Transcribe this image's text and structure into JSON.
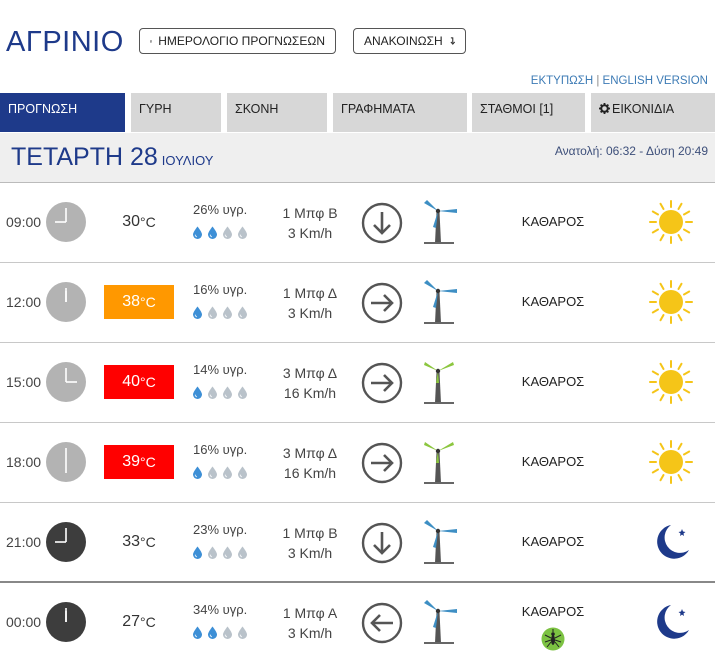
{
  "header": {
    "city": "ΑΓΡΙΝΙΟ",
    "calendar_button": "ΗΜΕΡΟΛΟΓΙΟ ΠΡΟΓΝΩΣΕΩΝ",
    "calendar_icon": "calendar-icon",
    "announcement_button": "ΑΝΑΚΟΙΝΩΣΗ",
    "announcement_icon": "arrow-down-icon"
  },
  "links": {
    "print": "ΕΚΤΥΠΩΣΗ",
    "separator": "|",
    "english": "ENGLISH VERSION"
  },
  "tabs": [
    {
      "label": "ΠΡΟΓΝΩΣΗ",
      "active": true
    },
    {
      "label": "ΓΥΡΗ"
    },
    {
      "label": "ΣΚΟΝΗ"
    },
    {
      "label": "ΓΡΑΦΗΜΑΤΑ"
    },
    {
      "label": "ΣΤΑΘΜΟΙ [1]"
    },
    {
      "label": "ΕΙΚΟΝΙΔΙΑ",
      "icon": "gear-icon"
    }
  ],
  "day": {
    "name": "ΤΕΤΑΡΤΗ 28",
    "month": "ΙΟΥΛΙΟΥ",
    "sun": "Ανατολή: 06:32  - Δύση 20:49"
  },
  "colors": {
    "brand": "#1e3a8a",
    "hot": "#ff9800",
    "very_hot": "#ff0000",
    "drop_filled": "#3d8fd6",
    "drop_empty": "#b9c2ca",
    "sun": "#f5c518",
    "moon": "#1e3a8a"
  },
  "units": {
    "temp": "°C"
  },
  "forecast": [
    {
      "time": "09:00",
      "temp": "30",
      "temp_level": "normal",
      "humidity": "26% υγρ.",
      "drops_filled": 2,
      "wind_bft": "1 Μπφ Β",
      "wind_kmh": "3 Km/h",
      "wind_dir": "arrow-down-icon",
      "turbine": "wind-turbine-icon",
      "condition": "ΚΑΘΑΡΟΣ",
      "weather_icon": "sun-icon",
      "dark_clock": false
    },
    {
      "time": "12:00",
      "temp": "38",
      "temp_level": "hot",
      "humidity": "16% υγρ.",
      "drops_filled": 1,
      "wind_bft": "1 Μπφ Δ",
      "wind_kmh": "3 Km/h",
      "wind_dir": "arrow-right-icon",
      "turbine": "wind-turbine-icon",
      "condition": "ΚΑΘΑΡΟΣ",
      "weather_icon": "sun-icon",
      "dark_clock": false
    },
    {
      "time": "15:00",
      "temp": "40",
      "temp_level": "very-hot",
      "humidity": "14% υγρ.",
      "drops_filled": 1,
      "wind_bft": "3 Μπφ Δ",
      "wind_kmh": "16 Km/h",
      "wind_dir": "arrow-right-icon",
      "turbine": "wind-turbine-icon",
      "condition": "ΚΑΘΑΡΟΣ",
      "weather_icon": "sun-icon",
      "dark_clock": false
    },
    {
      "time": "18:00",
      "temp": "39",
      "temp_level": "very-hot",
      "humidity": "16% υγρ.",
      "drops_filled": 1,
      "wind_bft": "3 Μπφ Δ",
      "wind_kmh": "16 Km/h",
      "wind_dir": "arrow-right-icon",
      "turbine": "wind-turbine-icon",
      "condition": "ΚΑΘΑΡΟΣ",
      "weather_icon": "sun-icon",
      "dark_clock": false
    },
    {
      "time": "21:00",
      "temp": "33",
      "temp_level": "normal",
      "humidity": "23% υγρ.",
      "drops_filled": 1,
      "wind_bft": "1 Μπφ Β",
      "wind_kmh": "3 Km/h",
      "wind_dir": "arrow-down-icon",
      "turbine": "wind-turbine-icon",
      "condition": "ΚΑΘΑΡΟΣ",
      "weather_icon": "moon-icon",
      "dark_clock": true
    },
    {
      "time": "00:00",
      "temp": "27",
      "temp_level": "normal",
      "humidity": "34% υγρ.",
      "drops_filled": 2,
      "wind_bft": "1 Μπφ Α",
      "wind_kmh": "3 Km/h",
      "wind_dir": "arrow-left-icon",
      "turbine": "wind-turbine-icon",
      "condition": "ΚΑΘΑΡΟΣ",
      "weather_icon": "moon-icon",
      "extra_icon": "mosquito-icon",
      "dark_clock": true
    }
  ]
}
